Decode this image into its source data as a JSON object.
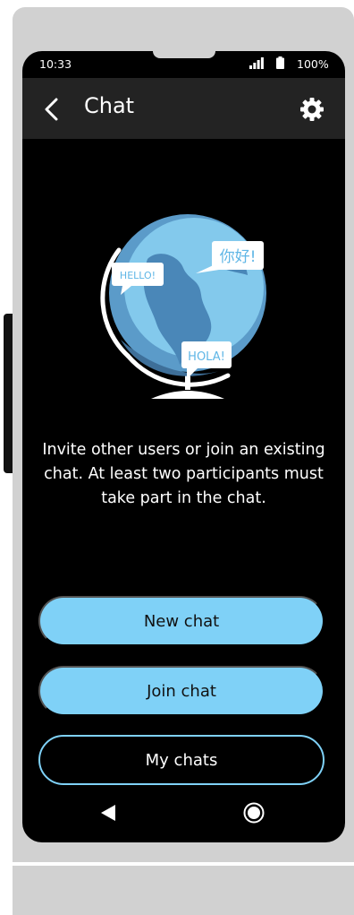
{
  "status_bar": {
    "time": "10:33",
    "battery": "100%"
  },
  "app_bar": {
    "title": "Chat"
  },
  "illustration": {
    "bubbles": {
      "hello": "HELLO!",
      "chinese": "你好!",
      "hola": "HOLA!"
    }
  },
  "description": "Invite other users or join an existing chat. At least two participants must take part in the chat.",
  "buttons": {
    "new_chat": "New chat",
    "join_chat": "Join chat",
    "my_chats": "My chats"
  },
  "colors": {
    "accent": "#7fd1f7",
    "screen": "#000000",
    "app_bar": "#232323",
    "device": "#d1d1d1"
  },
  "icons": [
    "back-arrow-icon",
    "settings-gear-icon",
    "signal-icon",
    "battery-icon",
    "nav-back-icon",
    "nav-home-icon"
  ]
}
